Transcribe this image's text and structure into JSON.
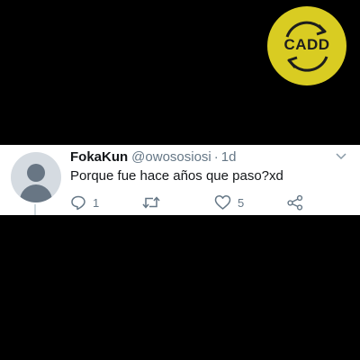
{
  "logo": {
    "text": "CADD",
    "background": "#d9cc22"
  },
  "tweet": {
    "display_name": "FokaKun",
    "handle": "@owososiosi",
    "separator": "·",
    "time": "1d",
    "text": "Porque fue hace años que paso?xd",
    "reply_count": "1",
    "retweet_count": "",
    "like_count": "5",
    "icons": [
      "chevron-down-icon",
      "reply-icon",
      "retweet-icon",
      "like-icon",
      "share-icon"
    ]
  }
}
